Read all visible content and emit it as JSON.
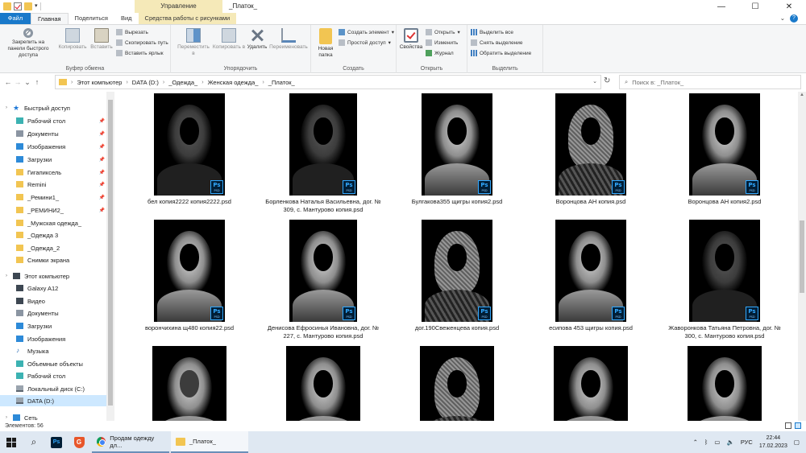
{
  "window": {
    "title": "_Платок_",
    "context_tab_header": "Управление",
    "controls": [
      "—",
      "☐",
      "✕"
    ]
  },
  "ribbon": {
    "tabs": [
      "Файл",
      "Главная",
      "Поделиться",
      "Вид",
      "Средства работы с рисунками"
    ],
    "clipboard": {
      "label": "Буфер обмена",
      "pin": "Закрепить на панели быстрого доступа",
      "copy": "Копировать",
      "paste": "Вставить",
      "cut": "Вырезать",
      "copy_path": "Скопировать путь",
      "paste_shortcut": "Вставить ярлык"
    },
    "organize": {
      "label": "Упорядочить",
      "move": "Переместить в",
      "copy": "Копировать в",
      "delete": "Удалить",
      "rename": "Переименовать"
    },
    "new": {
      "label": "Создать",
      "new_folder": "Новая папка",
      "new_item": "Создать элемент",
      "easy_access": "Простой доступ"
    },
    "open": {
      "label": "Открыть",
      "properties": "Свойства",
      "open": "Открыть",
      "edit": "Изменить",
      "history": "Журнал"
    },
    "select": {
      "label": "Выделить",
      "all": "Выделить все",
      "none": "Снять выделение",
      "invert": "Обратить выделение"
    }
  },
  "address": {
    "path": [
      "Этот компьютер",
      "DATA (D:)",
      "_Одежда_",
      "Женская одежда_",
      "_Платок_"
    ],
    "search_placeholder": "Поиск в: _Платок_"
  },
  "nav": {
    "quick_access": "Быстрый доступ",
    "quick_items": [
      "Рабочий стол",
      "Документы",
      "Изображения",
      "Загрузки",
      "Гигапиксель",
      "Remini",
      "_Ремини1_",
      "_РЕМИНИ2_",
      "_Мужская одежда_",
      "_Одежда 3",
      "_Одежда_2",
      "Снимки экрана"
    ],
    "this_pc": "Этот компьютер",
    "pc_items": [
      "Galaxy A12",
      "Видео",
      "Документы",
      "Загрузки",
      "Изображения",
      "Музыка",
      "Объемные объекты",
      "Рабочий стол",
      "Локальный диск (C:)",
      "DATA (D:)"
    ],
    "network": "Сеть"
  },
  "files": [
    "бел копия2222 копия2222.psd",
    "Борленкова Наталья Васильевна, дог. № 309, с. Мантурово копия.psd",
    "Булгакова355 щигры копия2.psd",
    "Воронцова АН копия.psd",
    "Воронцова АН копия2.psd",
    "ворончихина щ480 копия22.psd",
    "Денисова Ефросинья Ивановна, дог. № 227, с. Мантурово копия.psd",
    "дог.190Свеженцева копия.psd",
    "есипова 453 щигры копия.psd",
    "Жаворонкова Татьяна Петровна, дог. № 300, с. Мантурово копия.psd",
    "",
    "",
    "",
    "",
    ""
  ],
  "psd_badge": {
    "letters": "Ps",
    "sub": "PSD"
  },
  "status": {
    "items_count": "Элементов: 56"
  },
  "taskbar": {
    "chrome_task": "Продам одежду дл...",
    "explorer_task": "_Платок_",
    "lang": "РУС",
    "time": "22:44",
    "date": "17.02.2023"
  }
}
